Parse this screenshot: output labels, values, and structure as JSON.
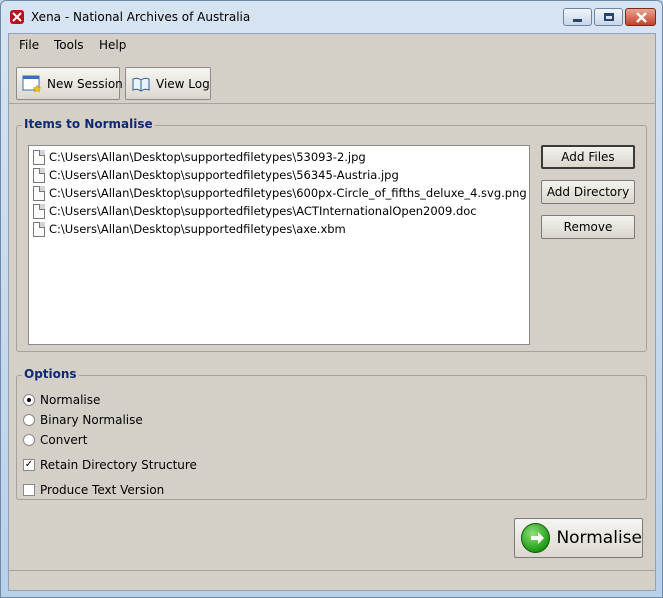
{
  "window": {
    "title": "Xena - National Archives of Australia"
  },
  "menu": [
    "File",
    "Tools",
    "Help"
  ],
  "toolbar": {
    "new_session_label": "New Session",
    "view_log_label": "View Log"
  },
  "items_group": {
    "title": "Items to Normalise",
    "files": [
      "C:\\Users\\Allan\\Desktop\\supportedfiletypes\\53093-2.jpg",
      "C:\\Users\\Allan\\Desktop\\supportedfiletypes\\56345-Austria.jpg",
      "C:\\Users\\Allan\\Desktop\\supportedfiletypes\\600px-Circle_of_fifths_deluxe_4.svg.png",
      "C:\\Users\\Allan\\Desktop\\supportedfiletypes\\ACTInternationalOpen2009.doc",
      "C:\\Users\\Allan\\Desktop\\supportedfiletypes\\axe.xbm"
    ],
    "add_files_label": "Add Files",
    "add_directory_label": "Add Directory",
    "remove_label": "Remove"
  },
  "options_group": {
    "title": "Options",
    "modes": [
      {
        "label": "Normalise",
        "selected": true
      },
      {
        "label": "Binary Normalise",
        "selected": false
      },
      {
        "label": "Convert",
        "selected": false
      }
    ],
    "retain_directory": {
      "label": "Retain Directory Structure",
      "checked": true
    },
    "produce_text": {
      "label": "Produce Text Version",
      "checked": false
    }
  },
  "normalise_button_label": "Normalise",
  "icons": {
    "app": "xena-app-icon",
    "new_session": "new-window-icon",
    "view_log": "open-book-icon",
    "normalise": "green-arrow-icon",
    "file": "document-icon"
  }
}
